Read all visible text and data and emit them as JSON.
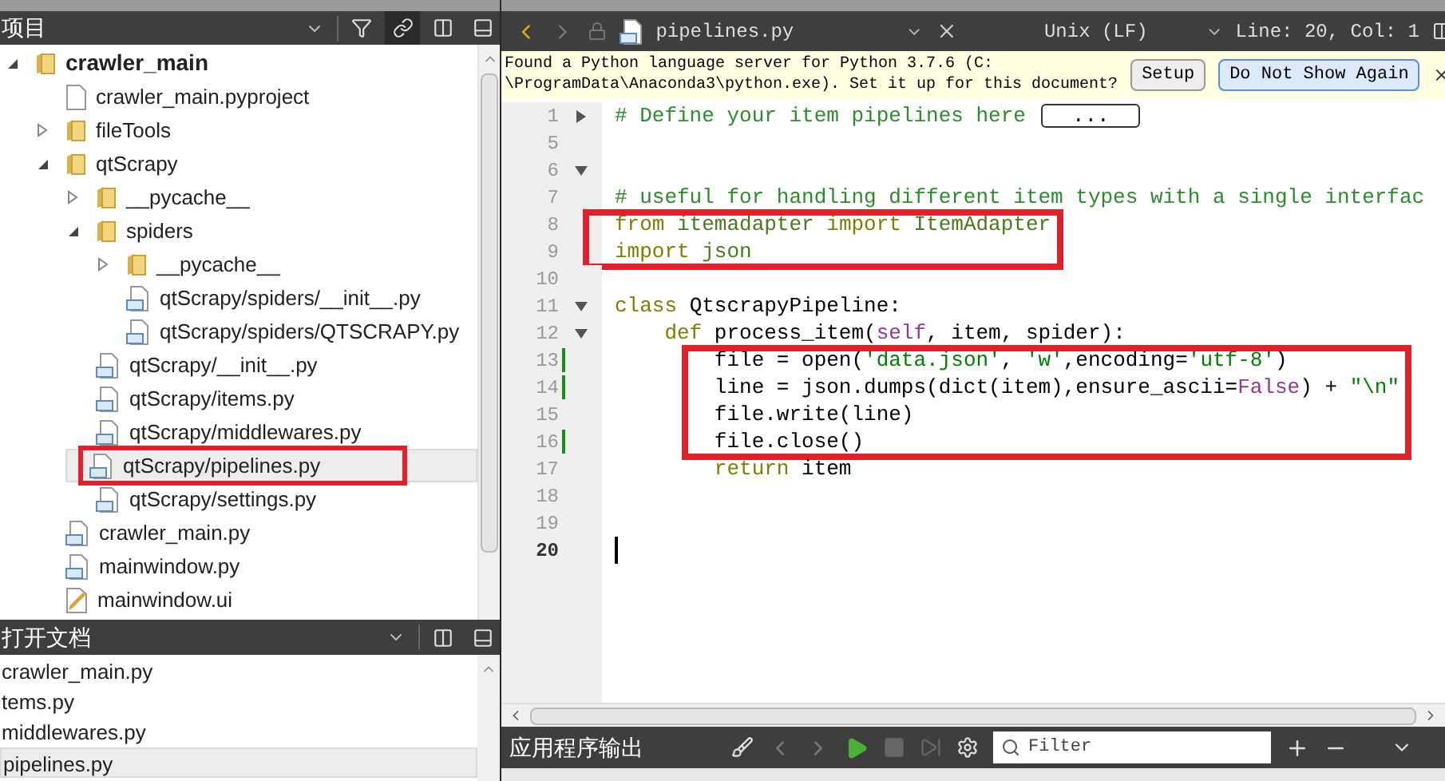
{
  "project_pane": {
    "title": "项目",
    "tree": [
      {
        "label": "crawler_main",
        "kind": "folder",
        "expanded": true,
        "selected": false,
        "annotated": false,
        "children": [
          {
            "label": "crawler_main.pyproject",
            "kind": "project-file",
            "selected": false,
            "annotated": false
          },
          {
            "label": "fileTools",
            "kind": "folder",
            "expanded": false,
            "selected": false,
            "annotated": false
          },
          {
            "label": "qtScrapy",
            "kind": "folder",
            "expanded": true,
            "selected": false,
            "annotated": false,
            "children": [
              {
                "label": "__pycache__",
                "kind": "folder",
                "expanded": false,
                "selected": false,
                "annotated": false
              },
              {
                "label": "spiders",
                "kind": "folder",
                "expanded": true,
                "selected": false,
                "annotated": false,
                "children": [
                  {
                    "label": "__pycache__",
                    "kind": "folder",
                    "expanded": false,
                    "selected": false,
                    "annotated": false
                  },
                  {
                    "label": "qtScrapy/spiders/__init__.py",
                    "kind": "python-file",
                    "selected": false,
                    "annotated": false
                  },
                  {
                    "label": "qtScrapy/spiders/QTSCRAPY.py",
                    "kind": "python-file",
                    "selected": false,
                    "annotated": false
                  }
                ]
              },
              {
                "label": "qtScrapy/__init__.py",
                "kind": "python-file",
                "selected": false,
                "annotated": false
              },
              {
                "label": "qtScrapy/items.py",
                "kind": "python-file",
                "selected": false,
                "annotated": false
              },
              {
                "label": "qtScrapy/middlewares.py",
                "kind": "python-file",
                "selected": false,
                "annotated": false
              },
              {
                "label": "qtScrapy/pipelines.py",
                "kind": "python-file",
                "selected": true,
                "annotated": true
              },
              {
                "label": "qtScrapy/settings.py",
                "kind": "python-file",
                "selected": false,
                "annotated": false
              }
            ]
          },
          {
            "label": "crawler_main.py",
            "kind": "python-file",
            "selected": false,
            "annotated": false
          },
          {
            "label": "mainwindow.py",
            "kind": "python-file",
            "selected": false,
            "annotated": false
          },
          {
            "label": "mainwindow.ui",
            "kind": "ui-file",
            "selected": false,
            "annotated": false
          }
        ]
      }
    ]
  },
  "open_documents": {
    "title": "打开文档",
    "items": [
      {
        "label": "crawler_main.py",
        "selected": false
      },
      {
        "label": "tems.py",
        "selected": false
      },
      {
        "label": "middlewares.py",
        "selected": false
      },
      {
        "label": "pipelines.py",
        "selected": true
      }
    ]
  },
  "editor_toolbar": {
    "file_name": "pipelines.py",
    "line_ending": "Unix (LF)",
    "position": "Line: 20, Col: 1"
  },
  "info_bar": {
    "message": "Found a Python language server for Python 3.7.6 (C:\n\\ProgramData\\Anaconda3\\python.exe). Set it up for this document?",
    "buttons": [
      "Setup",
      "Do Not Show Again"
    ]
  },
  "code_blocks": [
    {
      "highlighted": false,
      "lines": [
        {
          "number": "1",
          "expanded": false,
          "changed": false,
          "current": false,
          "folded_placeholder": "...",
          "tokens": [
            {
              "kind": "comment",
              "text": "# Define your item pipelines here"
            }
          ]
        },
        {
          "number": "5",
          "changed": false,
          "current": false
        },
        {
          "number": "6",
          "expanded": true,
          "changed": false,
          "current": false
        },
        {
          "number": "7",
          "changed": false,
          "current": false,
          "tokens": [
            {
              "kind": "comment",
              "text": "# useful for handling different item types with a single interfac"
            }
          ]
        }
      ]
    },
    {
      "highlighted": true,
      "lines": [
        {
          "number": "8",
          "changed": false,
          "current": false,
          "tokens": [
            {
              "kind": "keyword",
              "text": "from"
            },
            {
              "kind": "module",
              "text": " itemadapter "
            },
            {
              "kind": "keyword",
              "text": "import"
            },
            {
              "kind": "module",
              "text": " ItemAdapter"
            }
          ]
        },
        {
          "number": "9",
          "changed": false,
          "current": false,
          "tokens": [
            {
              "kind": "keyword",
              "text": "import"
            },
            {
              "kind": "module",
              "text": " json"
            }
          ]
        }
      ]
    },
    {
      "highlighted": false,
      "lines": [
        {
          "number": "10",
          "changed": false,
          "current": false
        },
        {
          "number": "11",
          "expanded": true,
          "changed": false,
          "current": false,
          "tokens": [
            {
              "kind": "keyword",
              "text": "class"
            },
            {
              "kind": "plain",
              "text": " QtscrapyPipeline:"
            }
          ]
        },
        {
          "number": "12",
          "expanded": true,
          "changed": false,
          "current": false,
          "tokens": [
            {
              "kind": "keyword",
              "text": "    def"
            },
            {
              "kind": "plain",
              "text": " process_item("
            },
            {
              "kind": "self",
              "text": "self"
            },
            {
              "kind": "plain",
              "text": ", item, spider):"
            }
          ]
        }
      ]
    },
    {
      "highlighted": true,
      "lines": [
        {
          "number": "13",
          "changed": true,
          "current": false,
          "tokens": [
            {
              "kind": "plain",
              "text": "        file = open("
            },
            {
              "kind": "string",
              "text": "'data.json'"
            },
            {
              "kind": "plain",
              "text": ", "
            },
            {
              "kind": "string",
              "text": "'w'"
            },
            {
              "kind": "plain",
              "text": ",encoding="
            },
            {
              "kind": "string",
              "text": "'utf-8'"
            },
            {
              "kind": "plain",
              "text": ")"
            }
          ]
        },
        {
          "number": "14",
          "changed": true,
          "current": false,
          "tokens": [
            {
              "kind": "plain",
              "text": "        line = json.dumps(dict(item),ensure_ascii="
            },
            {
              "kind": "self",
              "text": "False"
            },
            {
              "kind": "plain",
              "text": ") + "
            },
            {
              "kind": "string",
              "text": "\"\\n\""
            }
          ]
        },
        {
          "number": "15",
          "changed": false,
          "current": false,
          "tokens": [
            {
              "kind": "plain",
              "text": "        file.write(line)"
            }
          ]
        },
        {
          "number": "16",
          "changed": true,
          "current": false,
          "tokens": [
            {
              "kind": "plain",
              "text": "        file.close()"
            }
          ]
        }
      ]
    },
    {
      "highlighted": false,
      "lines": [
        {
          "number": "17",
          "changed": false,
          "current": false,
          "tokens": [
            {
              "kind": "keyword",
              "text": "        return"
            },
            {
              "kind": "plain",
              "text": " item"
            }
          ]
        },
        {
          "number": "18",
          "changed": false,
          "current": false
        },
        {
          "number": "19",
          "changed": false,
          "current": false
        },
        {
          "number": "20",
          "changed": false,
          "current": true
        }
      ]
    }
  ],
  "output_pane": {
    "title": "应用程序输出",
    "filter_placeholder": "Filter"
  }
}
